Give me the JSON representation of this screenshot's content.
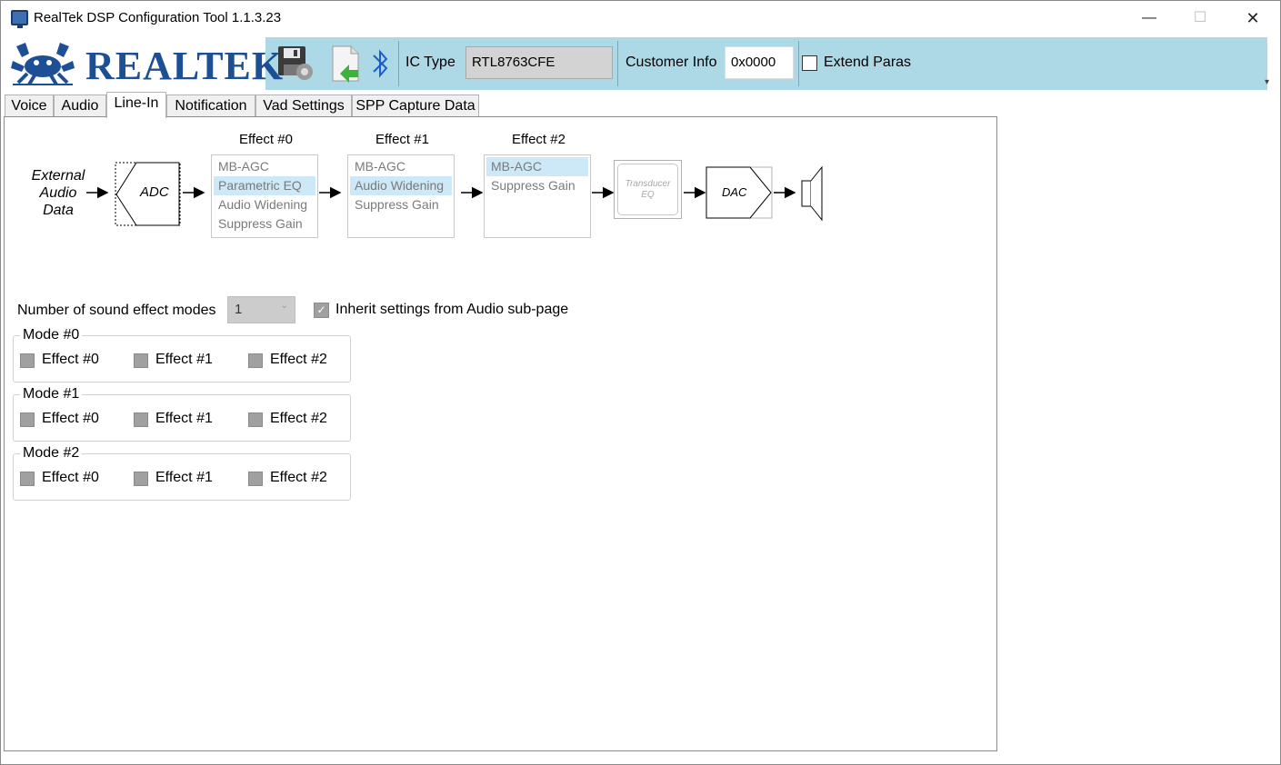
{
  "window": {
    "title": "RealTek DSP Configuration Tool 1.1.3.23",
    "controls": {
      "minimize": "—",
      "maximize": "☐",
      "close": "✕"
    }
  },
  "toolbar": {
    "logo_text": "REALTEK",
    "ic_type_label": "IC Type",
    "ic_type_value": "RTL8763CFE",
    "customer_info_label": "Customer Info",
    "customer_info_value": "0x0000",
    "extend_paras_label": "Extend Paras",
    "extend_paras_checked": false
  },
  "tabs": [
    {
      "label": "Voice",
      "active": false
    },
    {
      "label": "Audio",
      "active": false
    },
    {
      "label": "Line-In",
      "active": true
    },
    {
      "label": "Notification",
      "active": false
    },
    {
      "label": "Vad Settings",
      "active": false
    },
    {
      "label": "SPP Capture Data",
      "active": false
    }
  ],
  "diagram": {
    "source_lines": [
      "External",
      "Audio",
      "Data"
    ],
    "adc_label": "ADC",
    "dac_label": "DAC",
    "transducer_label_lines": [
      "Transducer",
      "EQ"
    ],
    "effects": [
      {
        "title": "Effect #0",
        "items": [
          "MB-AGC",
          "Parametric EQ",
          "Audio Widening",
          "Suppress Gain"
        ],
        "selected": 1
      },
      {
        "title": "Effect #1",
        "items": [
          "MB-AGC",
          "Audio Widening",
          "Suppress Gain"
        ],
        "selected": 1
      },
      {
        "title": "Effect #2",
        "items": [
          "MB-AGC",
          "Suppress Gain"
        ],
        "selected": 0
      }
    ]
  },
  "modes": {
    "count_label": "Number of sound effect modes",
    "count_value": "1",
    "inherit_label": "Inherit settings from Audio sub-page",
    "inherit_checked": true,
    "groups": [
      {
        "title": "Mode #0",
        "effects": [
          "Effect #0",
          "Effect #1",
          "Effect #2"
        ]
      },
      {
        "title": "Mode #1",
        "effects": [
          "Effect #0",
          "Effect #1",
          "Effect #2"
        ]
      },
      {
        "title": "Mode #2",
        "effects": [
          "Effect #0",
          "Effect #1",
          "Effect #2"
        ]
      }
    ]
  },
  "colors": {
    "toolbar_bg": "#add8e6",
    "logo_blue": "#1d4f95",
    "selected_item_bg": "#cde8f6",
    "disabled_gray": "#a0a0a0"
  }
}
